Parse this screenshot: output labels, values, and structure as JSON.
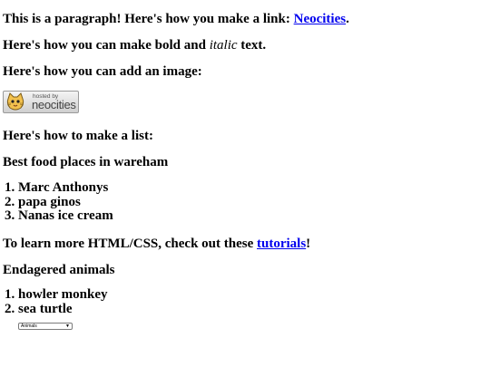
{
  "paragraph": {
    "text_before": "This is a paragraph! Here's how you make a link: ",
    "link": "Neocities",
    "text_after": "."
  },
  "formatting": {
    "before": "Here's how you can make bold and ",
    "italic": "italic",
    "after": " text."
  },
  "image_heading": "Here's how you can add an image:",
  "badge": {
    "hosted_by": "hosted by",
    "brand": "neocities"
  },
  "list_heading": "Here's how to make a list:",
  "food": {
    "heading": "Best food places in wareham",
    "items": [
      "Marc Anthonys",
      "papa ginos",
      "Nanas ice cream"
    ]
  },
  "learn": {
    "before": "To learn more HTML/CSS, check out these ",
    "link": "tutorials",
    "after": "!"
  },
  "animals": {
    "heading": "Endagered animals",
    "items": [
      "howler monkey",
      "sea turtle"
    ]
  },
  "dropdown": {
    "selected": "Animals"
  },
  "colors": {
    "link": "#0000ee",
    "text": "#000000"
  }
}
